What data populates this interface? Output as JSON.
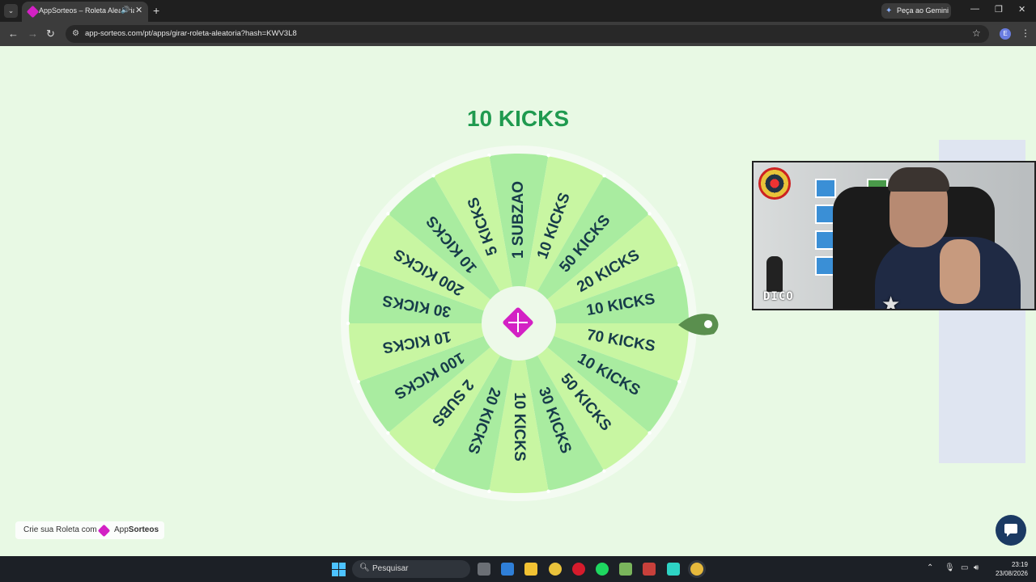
{
  "browser": {
    "tab_title": "AppSorteos – Roleta Aleatória",
    "tab_audio_icon": "speaker-icon",
    "new_tab_label": "+",
    "gemini_label": "Peça ao Gemini",
    "url": "app-sorteos.com/pt/apps/girar-roleta-aleatoria?hash=KWV3L8",
    "profile_initial": "E",
    "minimize": "—",
    "restore": "❐",
    "close": "✕"
  },
  "page": {
    "result": "10 KICKS",
    "wheel": {
      "segments": [
        "1 SUBZAO",
        "10 KICKS",
        "50 KICKS",
        "20 KICKS",
        "10 KICKS",
        "70 KICKS",
        "10 KICKS",
        "50 KICKS",
        "30 KICKS",
        "10 KICKS",
        "20 KICKS",
        "2 SUBS",
        "100 KICKS",
        "10 KICKS",
        "30 KICKS",
        "200 KICKS",
        "10 KICKS",
        "5 KICKS"
      ],
      "colors": [
        "#a9eca0",
        "#c8f6a2"
      ],
      "center_logo_color": "#d321c4",
      "pointer_color": "#5a8f4e"
    },
    "webcam": {
      "overlay_text": "DICO"
    },
    "brand": {
      "prefix": "Crie sua Roleta com",
      "name_light": "App",
      "name_bold": "Sorteos"
    }
  },
  "taskbar": {
    "search_placeholder": "Pesquisar",
    "time": "23:19",
    "date": "23/08/2026"
  }
}
